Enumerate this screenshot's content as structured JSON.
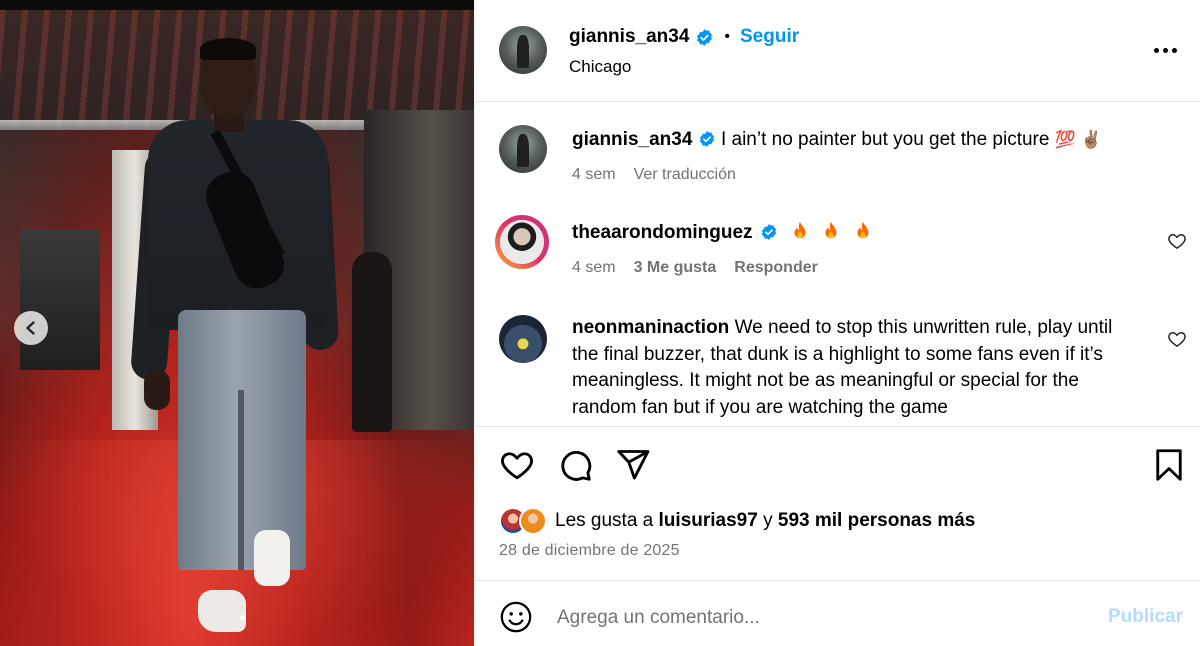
{
  "colors": {
    "link_blue": "#0095f6",
    "publish_disabled": "#b3dbff",
    "meta_gray": "#737373",
    "verified_blue": "#0095f6",
    "fire_orange": "#ff6a00"
  },
  "media": {
    "prev_icon": "chevron-left-icon",
    "slide_indicator": "dot"
  },
  "header": {
    "username": "giannis_an34",
    "separator": "•",
    "follow_label": "Seguir",
    "location": "Chicago",
    "more_icon": "more-horizontal-icon"
  },
  "caption": {
    "username": "giannis_an34",
    "text": "I ain’t no painter but you get the picture",
    "emojis": "💯 ✌🏽",
    "time": "4 sem",
    "translate_label": "Ver traducción"
  },
  "comments": [
    {
      "username": "theaarondominguez",
      "text": "",
      "time": "4 sem",
      "likes": "3 Me gusta",
      "reply_label": "Responder",
      "fires": 3
    },
    {
      "username": "neonmaninaction",
      "text": "We need to stop this unwritten rule, play until the final buzzer, that dunk is a highlight to some fans even if it’s meaningless. It might not be as meaningful or special for the random fan but if you are watching the game"
    }
  ],
  "actions": {
    "like_icon": "heart-icon",
    "comment_icon": "comment-icon",
    "share_icon": "send-icon",
    "save_icon": "bookmark-icon"
  },
  "likes": {
    "prefix": "Les gusta a",
    "user": "luisurias97",
    "conjunction": "y",
    "others": "593 mil personas más"
  },
  "date": "28 de diciembre de 2025",
  "add_comment": {
    "placeholder": "Agrega un comentario...",
    "publish_label": "Publicar"
  }
}
